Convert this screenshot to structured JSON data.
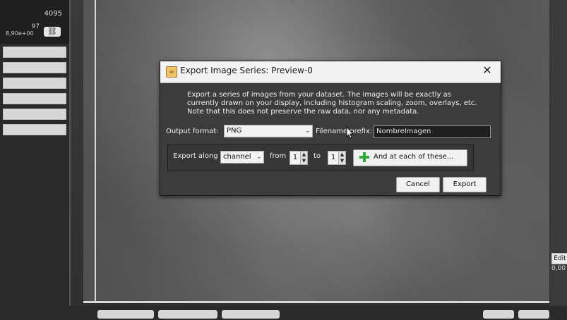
{
  "left_panel": {
    "max_value": "4095",
    "mid_value": "97",
    "min_value": "8,90e+00",
    "link_icon": "link-icon"
  },
  "right_panel": {
    "edit_label": "Edit",
    "value": "0,00"
  },
  "dialog": {
    "title": "Export Image Series: Preview-0",
    "description": "Export a series of images from your dataset. The images will be exactly as currently drawn on your display, including histogram scaling, zoom, overlays, etc. Note that this does not preserve the raw data, nor any metadata.",
    "output_format_label": "Output format:",
    "output_format_value": "PNG",
    "filename_prefix_label": "Filename prefix:",
    "filename_prefix_value": "NombreImagen",
    "export_along_label": "Export along",
    "export_along_value": "channel",
    "from_label": "from",
    "from_value": "1",
    "to_label": "to",
    "to_value": "1",
    "and_each_label": "And at each of these...",
    "cancel_label": "Cancel",
    "export_label": "Export"
  },
  "colors": {
    "dialog_bg": "#3c3c3c",
    "title_bar_bg": "#f3f3f3",
    "add_icon_green": "#2fa93a"
  }
}
